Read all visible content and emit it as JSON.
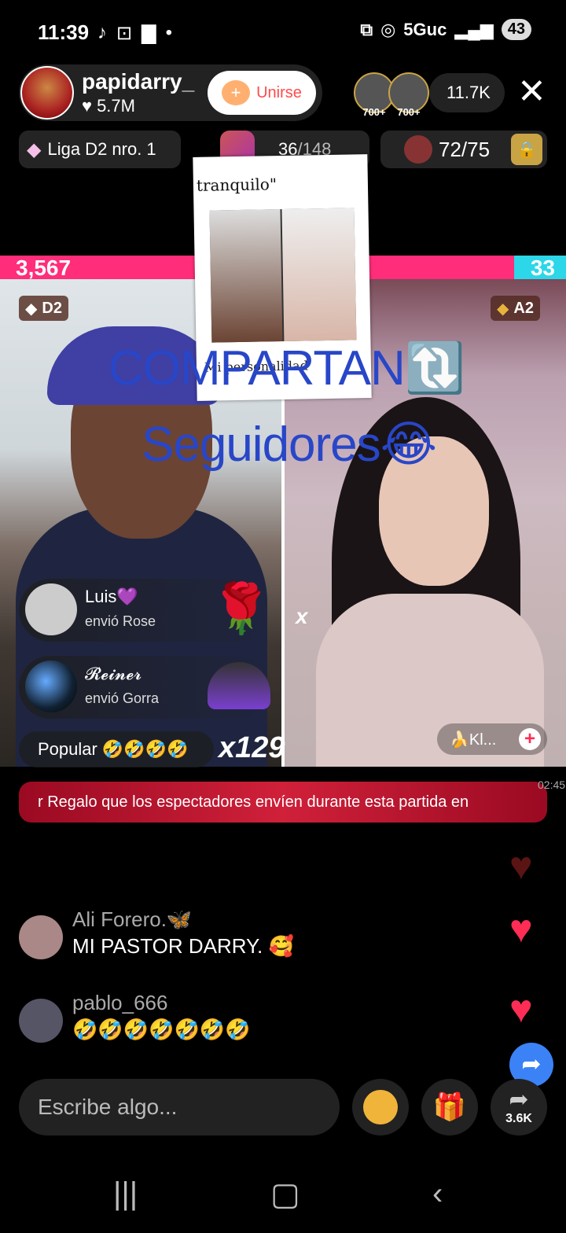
{
  "status_bar": {
    "time": "11:39",
    "network": "5Guc",
    "battery": "43"
  },
  "host": {
    "name": "papidarry_",
    "likes": "5.7M",
    "join_label": "Unirse"
  },
  "viewers": {
    "badge_1": "700+",
    "badge_2": "700+",
    "count": "11.7K"
  },
  "league": {
    "label": "Liga D2 nro. 1"
  },
  "goal": {
    "current": "36",
    "total": "/148"
  },
  "gold_goal": {
    "value": "72/75"
  },
  "battle": {
    "left_score": "3,567",
    "right_score": "33",
    "left_rank": "D2",
    "right_rank": "A2",
    "x_mark": "x"
  },
  "post_overlay": {
    "caption": "tranquilo\"",
    "footer": "Mi personalidad"
  },
  "overlay_text": {
    "line1": "COMPARTAN🔃",
    "line2": "Seguidores😂"
  },
  "gifts": [
    {
      "name": "Luis💜",
      "action": "envió Rose",
      "gift_icon": "🌹"
    },
    {
      "name": "𝓡𝓮𝓲𝓷𝓮𝓻",
      "action": "envió Gorra",
      "gift_icon": "cap"
    }
  ],
  "popular": {
    "label": "Popular",
    "emojis": "🤣🤣🤣🤣"
  },
  "combo": "x129",
  "opponent_tag": {
    "label": "🍌Kl..."
  },
  "banner": {
    "text": "r Regalo que los espectadores envíen durante esta partida en",
    "timer": "02:45"
  },
  "comments": [
    {
      "user": "Ali Forero.🦋",
      "message": "MI PASTOR DARRY. 🥰"
    },
    {
      "user": "pablo_666",
      "message": "🤣🤣🤣🤣🤣🤣🤣"
    }
  ],
  "input": {
    "placeholder": "Escribe algo..."
  },
  "share": {
    "count": "3.6K"
  },
  "colors": {
    "accent": "#ff2d7a",
    "opponent": "#2bd7e8",
    "banner": "#c0182f",
    "overlay_text": "#2846c8"
  }
}
